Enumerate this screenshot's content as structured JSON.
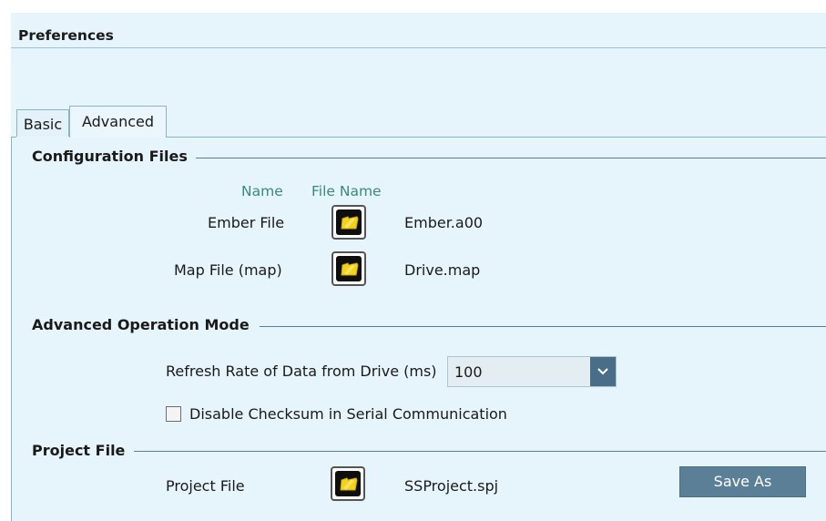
{
  "header": {
    "title": "Preferences"
  },
  "tabs": [
    {
      "label": "Basic",
      "active": false
    },
    {
      "label": "Advanced",
      "active": true
    }
  ],
  "config_files": {
    "heading": "Configuration Files",
    "columns": [
      "Name",
      "File Name"
    ],
    "rows": [
      {
        "name": "Ember File",
        "file": "Ember.a00",
        "icon": "open-folder-icon"
      },
      {
        "name": "Map File (map)",
        "file": "Drive.map",
        "icon": "open-folder-icon"
      }
    ]
  },
  "advanced_mode": {
    "heading": "Advanced Operation Mode",
    "refresh_label": "Refresh Rate of Data from Drive (ms)",
    "refresh_value": "100",
    "checksum_label": "Disable Checksum in Serial Communication",
    "checksum_checked": false
  },
  "project_file": {
    "heading": "Project File",
    "label": "Project File",
    "file": "SSProject.spj",
    "icon": "open-folder-icon",
    "save_as_label": "Save As"
  },
  "colors": {
    "panel_bg": "#e6f4fb",
    "accent": "#5b7f96",
    "column_header": "#3a8a7a",
    "folder_yellow": "#f2d21b"
  }
}
